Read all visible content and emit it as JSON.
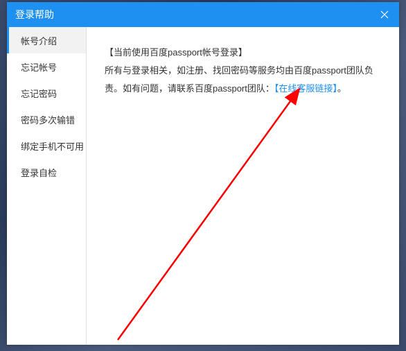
{
  "window": {
    "title": "登录帮助"
  },
  "sidebar": {
    "items": [
      {
        "label": "帐号介绍"
      },
      {
        "label": "忘记帐号"
      },
      {
        "label": "忘记密码"
      },
      {
        "label": "密码多次输错"
      },
      {
        "label": "绑定手机不可用"
      },
      {
        "label": "登录自检"
      }
    ]
  },
  "content": {
    "title": "【当前使用百度passport帐号登录】",
    "body_part1": "所有与登录相关，如注册、找回密码等服务均由百度passport团队负责。如有问题，请联系百度passport团队：",
    "link": "【在线客服链接】",
    "body_part2": "。"
  }
}
